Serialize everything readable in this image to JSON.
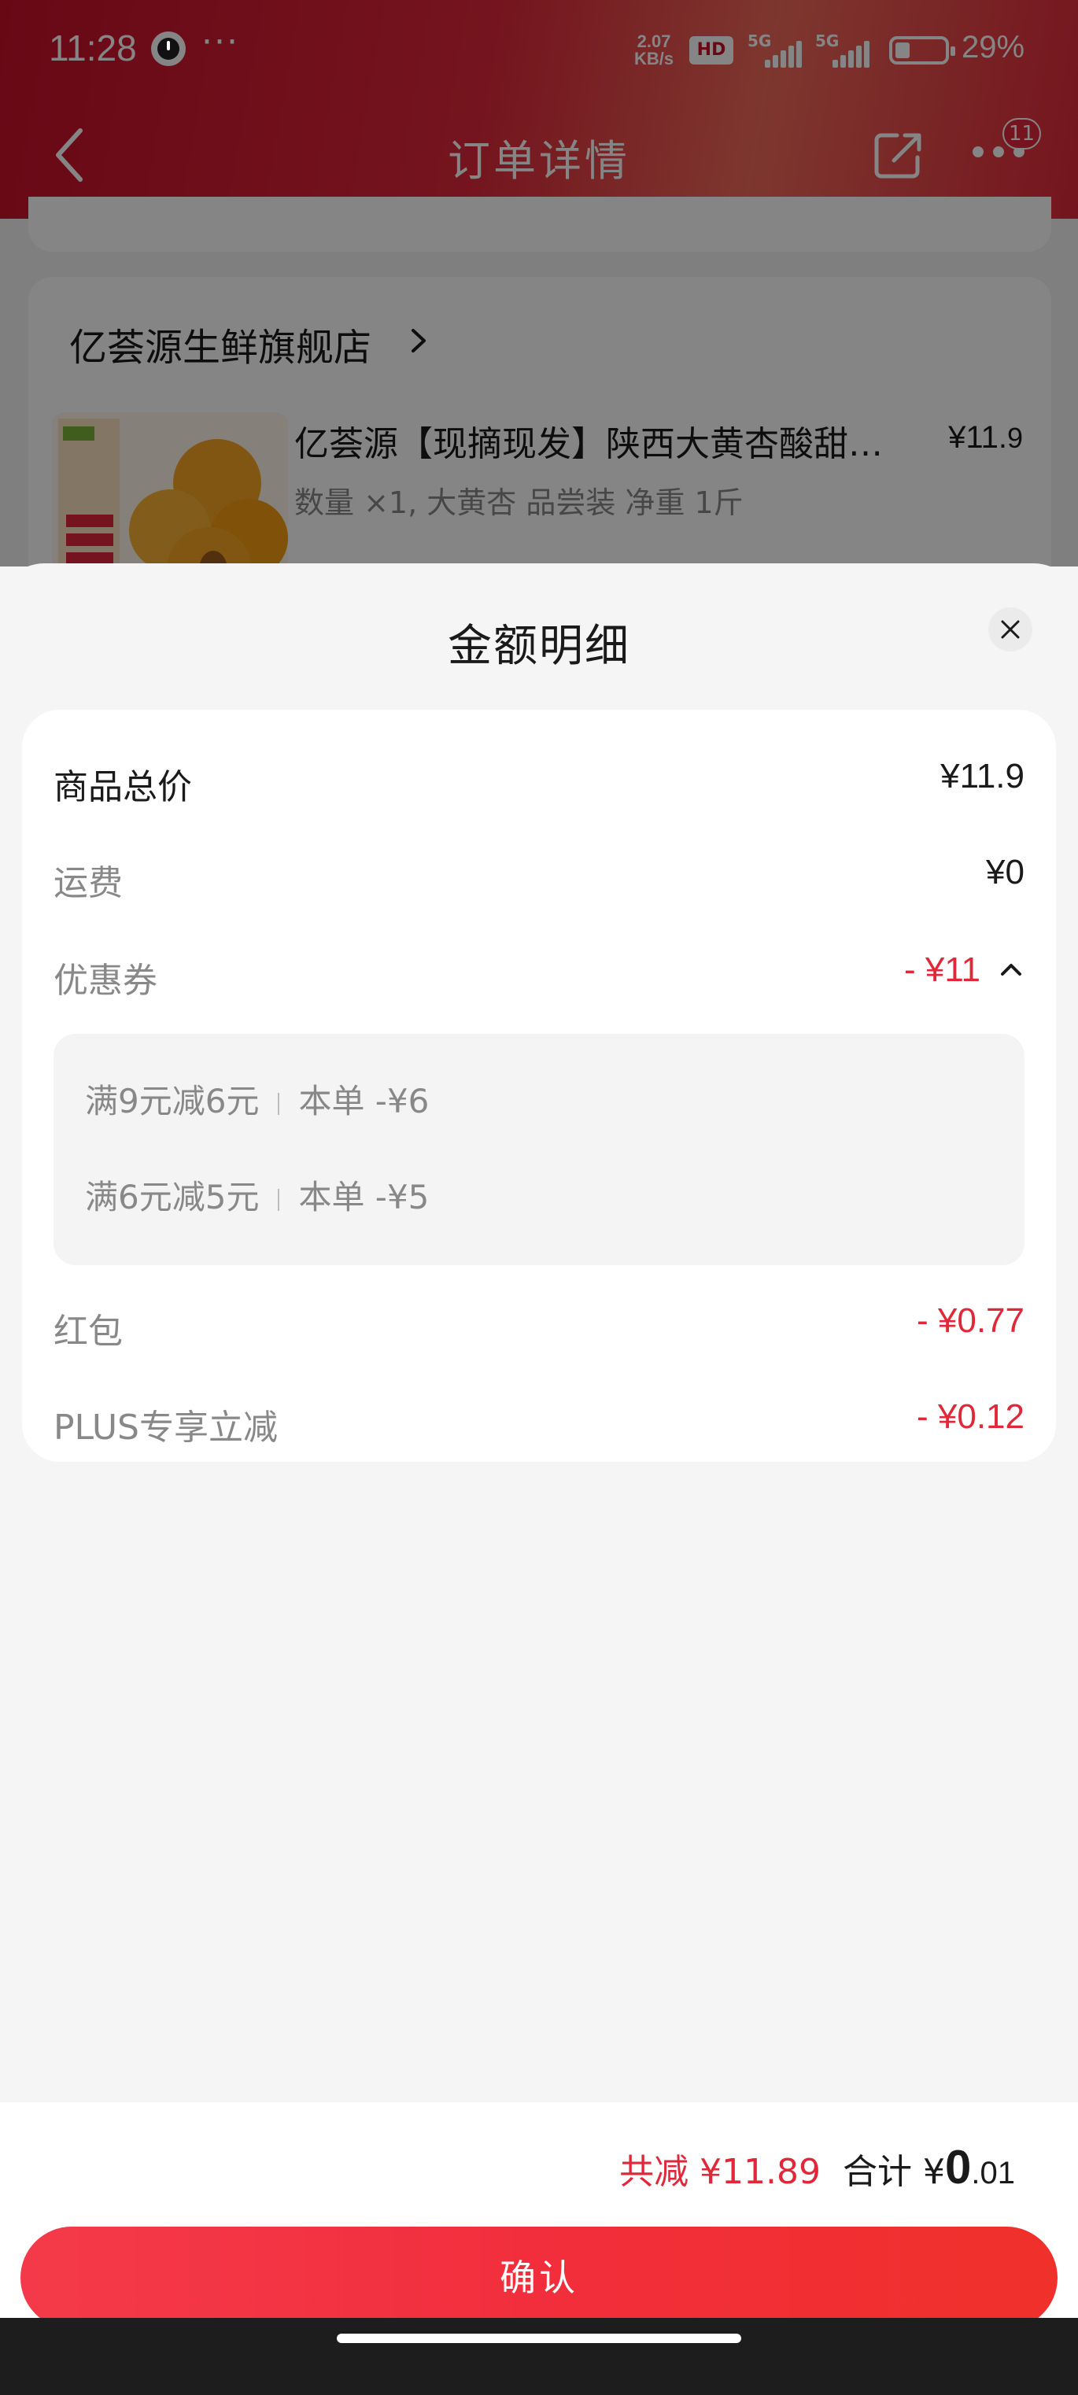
{
  "status_bar": {
    "time": "11:28",
    "network_speed_value": "2.07",
    "network_speed_unit": "KB/s",
    "hd_label": "HD",
    "signal1_label": "5G",
    "signal2_label": "5G",
    "battery_percent": "29%"
  },
  "header": {
    "title": "订单详情",
    "notification_count": "11"
  },
  "store": {
    "name": "亿荟源生鲜旗舰店",
    "product": {
      "name": "亿荟源【现摘现发】陕西大黄杏酸甜可口",
      "price": "¥11.",
      "price_decimal": "9",
      "spec": "数量 ×1, 大黄杏 品尝装 净重 1斤"
    }
  },
  "sheet": {
    "title": "金额明细",
    "rows": {
      "goods_total": {
        "label": "商品总价",
        "value": "¥11.9"
      },
      "shipping": {
        "label": "运费",
        "value": "¥0"
      },
      "coupon": {
        "label": "优惠券",
        "value": "- ¥11"
      },
      "red_packet": {
        "label": "红包",
        "value": "- ¥0.77"
      },
      "plus": {
        "label": "PLUS专享立减",
        "value": "- ¥0.12"
      }
    },
    "coupons": [
      {
        "rule": "满9元减6元",
        "scope": "本单 -¥6"
      },
      {
        "rule": "满6元减5元",
        "scope": "本单 -¥5"
      }
    ]
  },
  "footer": {
    "saved": "共减 ¥11.89",
    "total_label": "合计 ¥",
    "total_int": "0",
    "total_dec": ".01",
    "confirm": "确认"
  },
  "colors": {
    "accent_red": "#e0283a",
    "header_red": "#c8102a"
  }
}
